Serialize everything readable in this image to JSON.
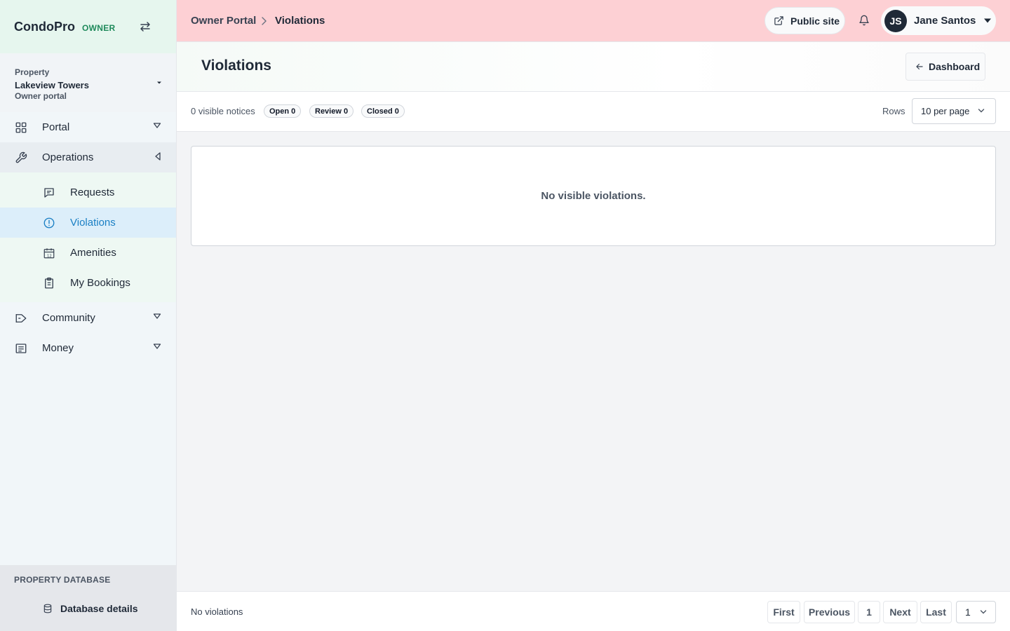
{
  "brand": {
    "name": "CondoPro",
    "role": "OWNER"
  },
  "property": {
    "label": "Property",
    "name": "Lakeview Towers",
    "subtitle": "Owner portal"
  },
  "nav": {
    "portal": "Portal",
    "operations": "Operations",
    "operations_items": [
      {
        "label": "Requests",
        "icon": "message-square-icon"
      },
      {
        "label": "Violations",
        "icon": "alert-circle-icon",
        "active": true
      },
      {
        "label": "Amenities",
        "icon": "calendar-icon"
      },
      {
        "label": "My Bookings",
        "icon": "clipboard-icon"
      }
    ],
    "community": "Community",
    "money": "Money"
  },
  "database": {
    "section_title": "PROPERTY DATABASE",
    "link": "Database details"
  },
  "topbar": {
    "breadcrumb": [
      "Owner Portal",
      "Violations"
    ],
    "public_site": "Public site",
    "user": {
      "initials": "JS",
      "name": "Jane Santos"
    }
  },
  "page": {
    "title": "Violations",
    "back_button": "Dashboard"
  },
  "filters": {
    "count_text": "0 visible notices",
    "pills": [
      "Open 0",
      "Review 0",
      "Closed 0"
    ],
    "rows_label": "Rows",
    "rows_value": "10 per page"
  },
  "empty": {
    "message": "No visible violations."
  },
  "footer": {
    "status": "No violations",
    "first": "First",
    "previous": "Previous",
    "page": "1",
    "next": "Next",
    "last": "Last",
    "page_select": "1"
  },
  "colors": {
    "topbar": "#fdd0d4",
    "brand_bg": "#e6f6ee",
    "active_bg": "#dceefa",
    "active_text": "#1a7fc4",
    "role": "#1f8a5b"
  }
}
